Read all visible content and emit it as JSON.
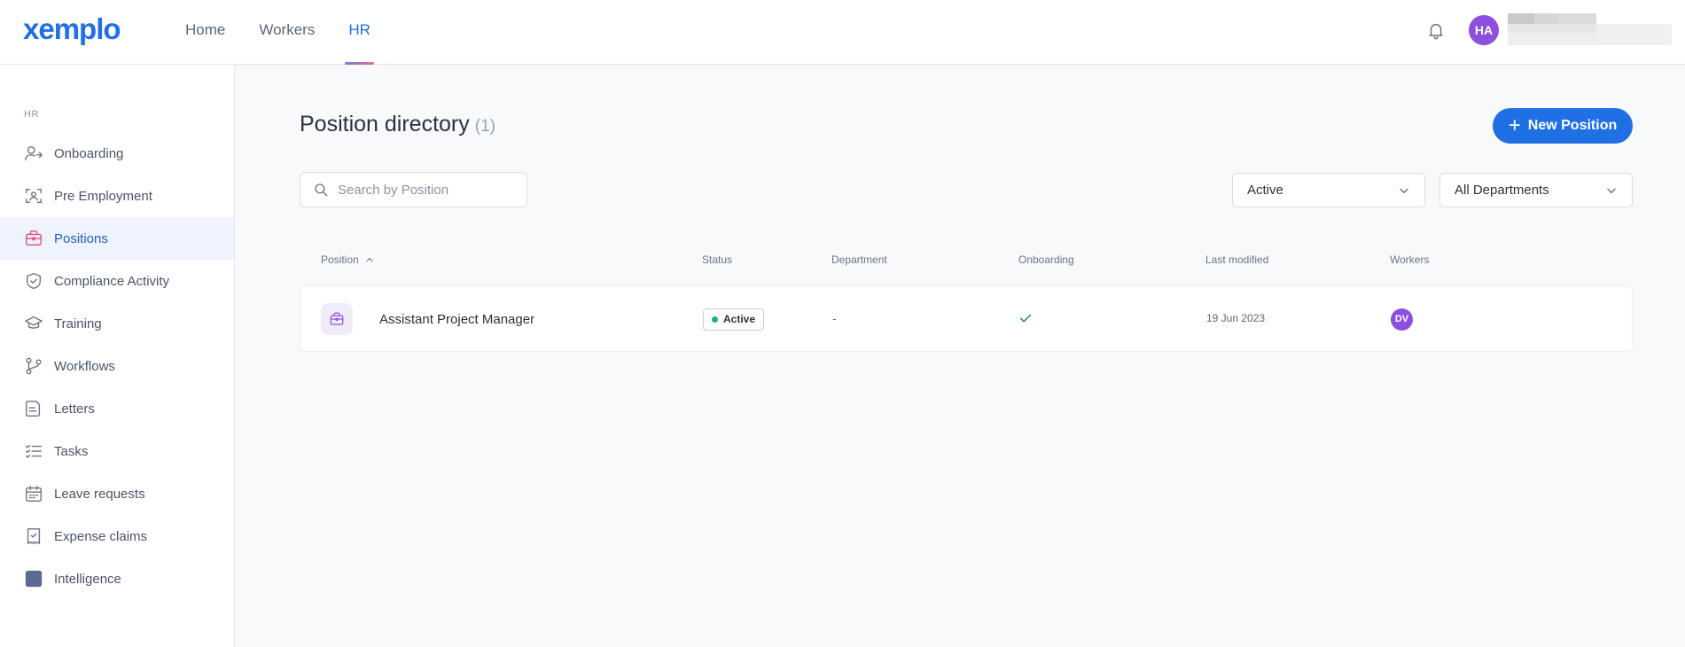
{
  "app": {
    "logo": "xemplo"
  },
  "nav": {
    "items": [
      {
        "label": "Home"
      },
      {
        "label": "Workers"
      },
      {
        "label": "HR"
      }
    ],
    "active": "HR"
  },
  "user": {
    "initials": "HA"
  },
  "sidebar": {
    "section": "HR",
    "items": [
      {
        "label": "Onboarding",
        "icon": "user-arrow-icon"
      },
      {
        "label": "Pre Employment",
        "icon": "user-scan-icon"
      },
      {
        "label": "Positions",
        "icon": "briefcase-icon"
      },
      {
        "label": "Compliance Activity",
        "icon": "shield-check-icon"
      },
      {
        "label": "Training",
        "icon": "graduation-cap-icon"
      },
      {
        "label": "Workflows",
        "icon": "workflow-branch-icon"
      },
      {
        "label": "Letters",
        "icon": "letter-icon"
      },
      {
        "label": "Tasks",
        "icon": "task-list-icon"
      },
      {
        "label": "Leave requests",
        "icon": "calendar-icon"
      },
      {
        "label": "Expense claims",
        "icon": "receipt-check-icon"
      },
      {
        "label": "Intelligence",
        "icon": "intelligence-square-icon"
      }
    ],
    "active": "Positions"
  },
  "main": {
    "title": "Position directory",
    "count": "(1)",
    "new_button": "New Position",
    "search_placeholder": "Search by Position",
    "status_filter": "Active",
    "department_filter": "All Departments",
    "columns": [
      "Position",
      "Status",
      "Department",
      "Onboarding",
      "Last modified",
      "Workers"
    ],
    "rows": [
      {
        "position": "Assistant Project Manager",
        "status": "Active",
        "department": "-",
        "onboarding": true,
        "last_modified": "19 Jun 2023",
        "worker_initials": "DV"
      }
    ]
  },
  "colors": {
    "brand": "#1f6fe5",
    "avatar": "#8d4fe0",
    "active_status": "#1ab27a"
  }
}
